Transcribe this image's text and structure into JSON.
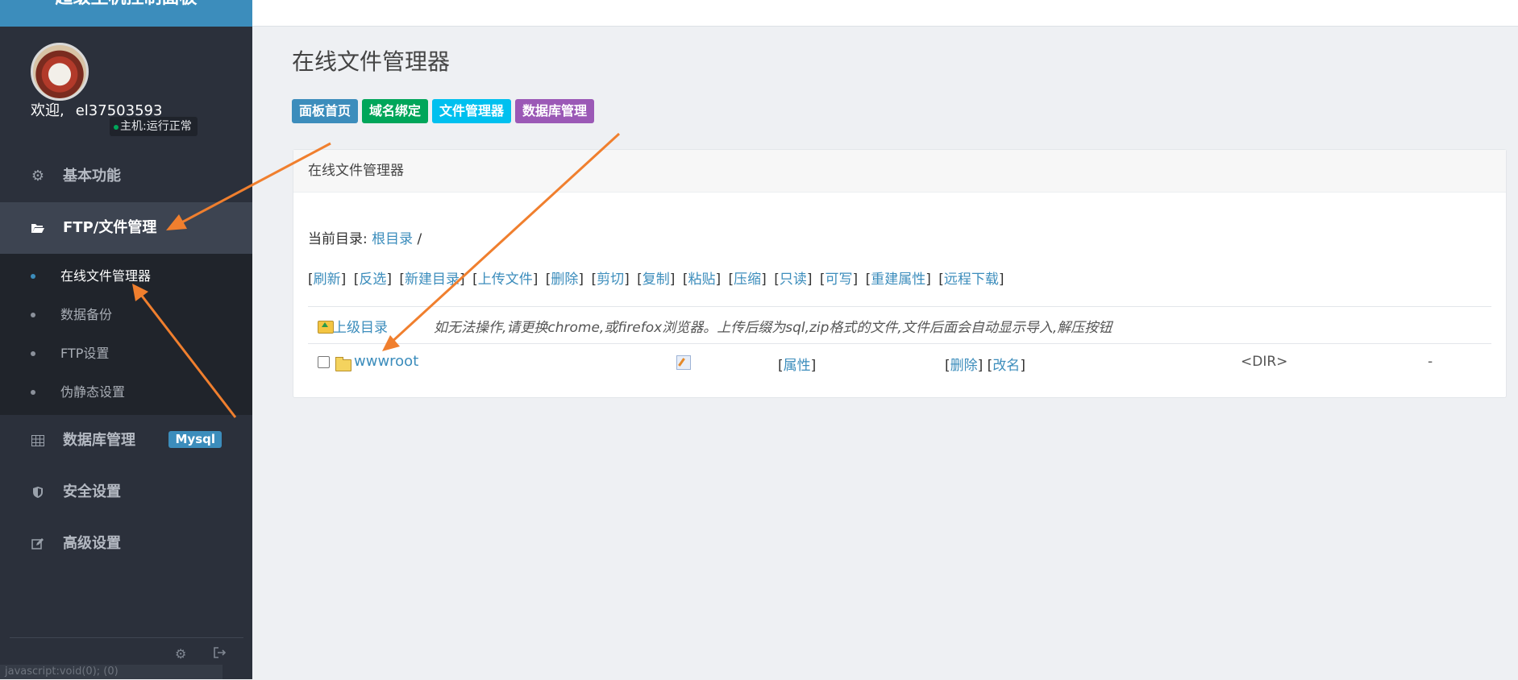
{
  "sidebar": {
    "brand": "超级主机控制面板",
    "user": {
      "welcome": "欢迎,",
      "username": "el37503593",
      "host_status": "主机:运行正常"
    },
    "menu": [
      {
        "label": "基本功能",
        "icon": "gears-icon"
      },
      {
        "label": "FTP/文件管理",
        "icon": "folder-open-icon",
        "active": true
      },
      {
        "label": "数据库管理",
        "icon": "table-icon",
        "badge": "Mysql"
      },
      {
        "label": "安全设置",
        "icon": "shield-icon"
      },
      {
        "label": "高级设置",
        "icon": "edit-icon"
      }
    ],
    "submenu": [
      {
        "label": "在线文件管理器",
        "active": true
      },
      {
        "label": "数据备份"
      },
      {
        "label": "FTP设置"
      },
      {
        "label": "伪静态设置"
      }
    ],
    "status_url": "javascript:void(0); (0)"
  },
  "main": {
    "title": "在线文件管理器",
    "quick_buttons": [
      {
        "label": "面板首页",
        "color": "#3c8dbc"
      },
      {
        "label": "域名绑定",
        "color": "#00a65a"
      },
      {
        "label": "文件管理器",
        "color": "#00c0ef"
      },
      {
        "label": "数据库管理",
        "color": "#9b59b6"
      }
    ],
    "panel": {
      "heading": "在线文件管理器",
      "current_dir_label": "当前目录:",
      "current_dir_link": "根目录",
      "current_dir_sep": "/",
      "toolbar": [
        "刷新",
        "反选",
        "新建目录",
        "上传文件",
        "删除",
        "剪切",
        "复制",
        "粘贴",
        "压缩",
        "只读",
        "可写",
        "重建属性",
        "远程下载"
      ],
      "up_dir": "上级目录",
      "hint": "如无法操作,请更换chrome,或firefox浏览器。上传后缀为sql,zip格式的文件,文件后面会自动显示导入,解压按钮",
      "files": [
        {
          "name": "wwwroot",
          "attr_link": "属性",
          "delete_link": "删除",
          "rename_link": "改名",
          "type": "<DIR>",
          "size": "-"
        }
      ]
    }
  },
  "colors": {
    "sidebar_bg": "#2b303b",
    "brand_bg": "#3c8dbc",
    "arrow": "#f07f2e",
    "link": "#3c8dbc"
  }
}
